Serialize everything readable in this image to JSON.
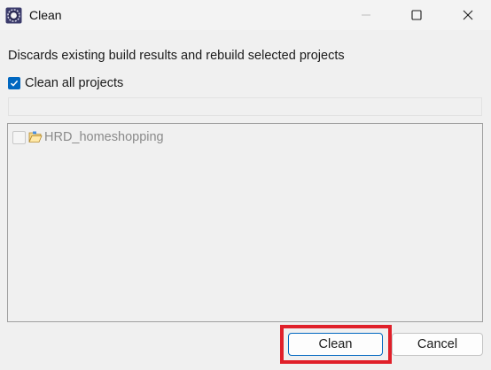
{
  "window": {
    "title": "Clean"
  },
  "titlebar": {
    "minimize_icon": "minimize-icon",
    "maximize_icon": "maximize-icon",
    "close_icon": "close-icon",
    "app_icon": "eclipse-app-icon"
  },
  "dialog": {
    "description": "Discards existing build results and rebuild selected projects",
    "clean_all_label": "Clean all projects",
    "clean_all_checked": true,
    "filter_placeholder": "",
    "projects": [
      {
        "name": "HRD_homeshopping",
        "checked": false,
        "icon": "open-folder-icon"
      }
    ]
  },
  "buttons": {
    "clean_label": "Clean",
    "cancel_label": "Cancel"
  },
  "colors": {
    "accent": "#0067c0",
    "highlight": "#e0202a",
    "background": "#f0f0f0",
    "disabled_text": "#8a8a8a"
  }
}
